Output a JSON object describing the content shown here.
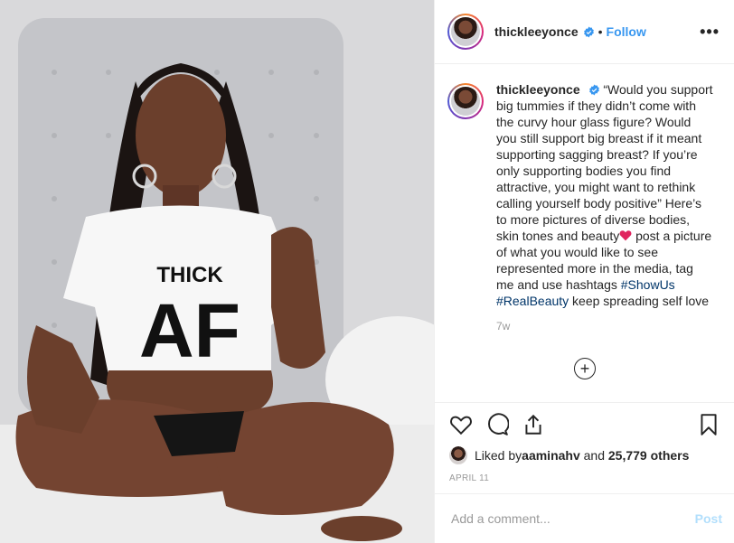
{
  "post": {
    "username": "thickleeyonce",
    "follow_label": "Follow",
    "dot": "•",
    "more_label": "•••",
    "shirt_text_top": "THICK",
    "shirt_text_bottom": "AF"
  },
  "caption": {
    "username": "thickleeyonce",
    "text_part1": "“Would you support big tummies if they didn’t come with the curvy hour glass figure? Would you still support big breast if it meant supporting sagging breast? If you’re only supporting bodies you find attractive, you might want to rethink calling yourself body positive” Here’s to more pictures of diverse bodies, skin tones and beauty",
    "text_part2": " post a picture of what you would like to see represented more in the media, tag me and use hashtags ",
    "hashtag1": "#ShowUs",
    "hashtag2": "#RealBeauty",
    "text_part3": " keep spreading self love",
    "time": "7w",
    "load_more_icon": "plus-circle-icon"
  },
  "actions": {
    "likes_prefix": "Liked by ",
    "liked_by_user": "aaminahv",
    "likes_middle": " and ",
    "likes_count": "25,779 others",
    "date": "APRIL 11"
  },
  "comment": {
    "placeholder": "Add a comment...",
    "post_label": "Post"
  },
  "colors": {
    "link_blue": "#3897f0",
    "hashtag": "#003569",
    "post_disabled": "#b2dffc",
    "heart_red": "#e0245e",
    "verified": "#3897f0"
  }
}
